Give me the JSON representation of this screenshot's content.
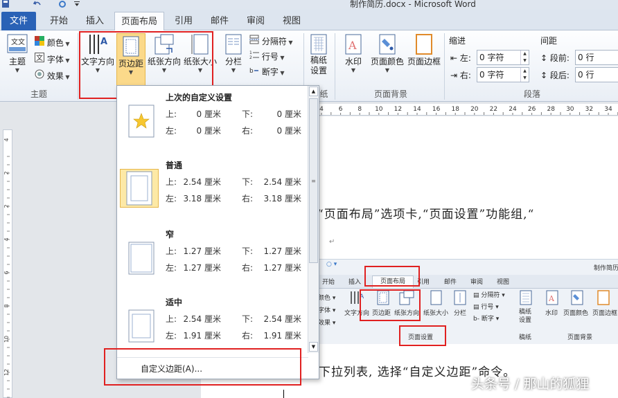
{
  "window": {
    "title": "制作简历.docx - Microsoft Word"
  },
  "tabs": [
    {
      "label": "文件"
    },
    {
      "label": "开始"
    },
    {
      "label": "插入"
    },
    {
      "label": "页面布局"
    },
    {
      "label": "引用"
    },
    {
      "label": "邮件"
    },
    {
      "label": "审阅"
    },
    {
      "label": "视图"
    }
  ],
  "ribbon": {
    "theme_group": {
      "label": "主题",
      "theme": "主题",
      "colors": "颜色",
      "fonts": "字体",
      "effects": "效果"
    },
    "page_setup": {
      "text_direction": "文字方向",
      "margins": "页边距",
      "orientation": "纸张方向",
      "size": "纸张大小",
      "columns": "分栏",
      "breaks": "分隔符",
      "line_numbers": "行号",
      "hyphenation": "断字"
    },
    "draft": {
      "settings": "稿纸设置",
      "label": "纸"
    },
    "background": {
      "label": "页面背景",
      "watermark": "水印",
      "page_color": "页面颜色",
      "page_borders": "页面边框"
    },
    "paragraph": {
      "label": "段落",
      "indent_label": "缩进",
      "spacing_label": "间距",
      "left": "左:",
      "left_value": "0 字符",
      "right": "右:",
      "right_value": "0 字符",
      "before": "段前:",
      "before_value": "0 行",
      "after": "段后:",
      "after_value": "0 行"
    }
  },
  "margins_menu": {
    "items": [
      {
        "title": "上次的自定义设置",
        "top_label": "上:",
        "top": "0 厘米",
        "bottom_label": "下:",
        "bottom": "0 厘米",
        "left_label": "左:",
        "left": "0 厘米",
        "right_label": "右:",
        "right": "0 厘米"
      },
      {
        "title": "普通",
        "top_label": "上:",
        "top": "2.54 厘米",
        "bottom_label": "下:",
        "bottom": "2.54 厘米",
        "left_label": "左:",
        "left": "3.18 厘米",
        "right_label": "右:",
        "right": "3.18 厘米"
      },
      {
        "title": "窄",
        "top_label": "上:",
        "top": "1.27 厘米",
        "bottom_label": "下:",
        "bottom": "1.27 厘米",
        "left_label": "左:",
        "left": "1.27 厘米",
        "right_label": "右:",
        "right": "1.27 厘米"
      },
      {
        "title": "适中",
        "top_label": "上:",
        "top": "2.54 厘米",
        "bottom_label": "下:",
        "bottom": "2.54 厘米",
        "left_label": "左:",
        "left": "1.91 厘米",
        "right_label": "右:",
        "right": "1.91 厘米"
      }
    ],
    "custom": "自定义边距(A)..."
  },
  "rulers": {
    "h_ticks": [
      "4",
      "6",
      "8",
      "10",
      "12",
      "14",
      "16",
      "18",
      "20",
      "22",
      "24",
      "26",
      "28",
      "30",
      "32",
      "34"
    ],
    "v_ticks": [
      "4",
      "2",
      "2",
      "4",
      "6",
      "8",
      "10",
      "12"
    ]
  },
  "document": {
    "line1": "“页面布局”选项卡,“页面设置”功能组,“",
    "line2": "下拉列表, 选择“自定义边距”命令。"
  },
  "embedded": {
    "title": "制作简历",
    "tabs": [
      "开始",
      "插入",
      "页面布局",
      "引用",
      "邮件",
      "审阅",
      "视图"
    ],
    "colors": "颜色",
    "fonts": "字体",
    "effects": "效果",
    "text_direction": "文字方向",
    "margins": "页边距",
    "orientation": "纸张方向",
    "size": "纸张大小",
    "columns": "分栏",
    "breaks": "分隔符",
    "line_numbers": "行号",
    "hyphenation": "断字",
    "draft": "稿纸设置",
    "watermark": "水印",
    "page_color": "页面颜色",
    "page_borders": "页面边框",
    "group_page_setup": "页面设置",
    "group_draft": "稿纸",
    "group_background": "页面背景"
  },
  "watermark": "头条号 / 那山的狐狸",
  "colors": {
    "accent": "#2a62b6",
    "highlight": "#e02020",
    "selected_item": "#fde9a6"
  }
}
